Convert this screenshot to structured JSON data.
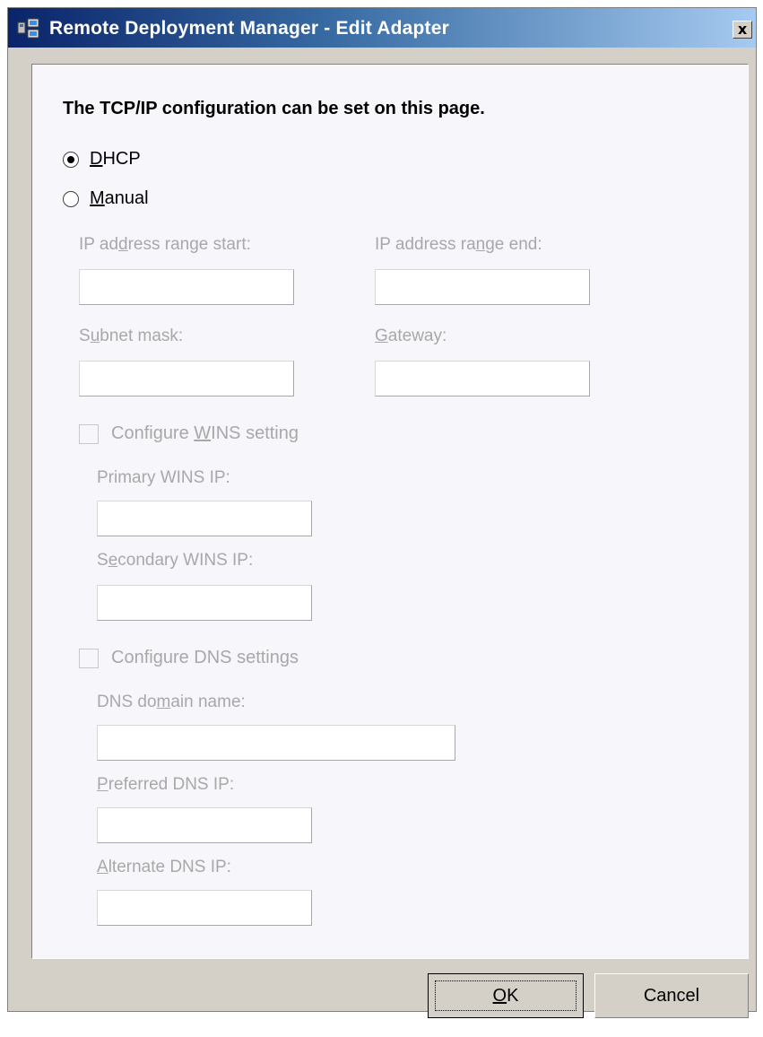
{
  "window": {
    "title": "Remote Deployment Manager - Edit Adapter",
    "close_label": "x"
  },
  "heading": "The TCP/IP configuration can be set on this page.",
  "mode": {
    "selected": "DHCP",
    "options": [
      {
        "label_pre": "",
        "label_key": "D",
        "label_post": "HCP",
        "checked": true
      },
      {
        "label_pre": "",
        "label_key": "M",
        "label_post": "anual",
        "checked": false
      }
    ]
  },
  "ip": {
    "range_start_label": {
      "pre": "IP ad",
      "key": "d",
      "post": "ress range start:"
    },
    "range_start_value": "",
    "range_end_label": {
      "pre": "IP address ra",
      "key": "n",
      "post": "ge end:"
    },
    "range_end_value": "",
    "subnet_label": {
      "pre": "S",
      "key": "u",
      "post": "bnet mask:"
    },
    "subnet_value": "",
    "gateway_label": {
      "pre": "",
      "key": "G",
      "post": "ateway:"
    },
    "gateway_value": ""
  },
  "wins": {
    "checkbox_label": {
      "pre": "Configure ",
      "key": "W",
      "post": "INS setting"
    },
    "checked": false,
    "primary_label": "Primary WINS IP:",
    "primary_value": "",
    "secondary_label": {
      "pre": "S",
      "key": "e",
      "post": "condary WINS IP:"
    },
    "secondary_value": ""
  },
  "dns": {
    "checkbox_label": {
      "pre": "Confi",
      "key": "g",
      "post": "ure DNS settings"
    },
    "checked": false,
    "domain_label": {
      "pre": "DNS do",
      "key": "m",
      "post": "ain name:"
    },
    "domain_value": "",
    "preferred_label": {
      "pre": "",
      "key": "P",
      "post": "referred DNS IP:"
    },
    "preferred_value": "",
    "alternate_label": {
      "pre": "",
      "key": "A",
      "post": "lternate DNS IP:"
    },
    "alternate_value": ""
  },
  "buttons": {
    "ok": {
      "pre": "",
      "key": "O",
      "post": "K"
    },
    "cancel": "Cancel"
  },
  "colors": {
    "title_gradient_start": "#0a246a",
    "title_gradient_end": "#a6caf0",
    "disabled_text": "#a8a8a8",
    "window_bg": "#d4d0c8"
  }
}
